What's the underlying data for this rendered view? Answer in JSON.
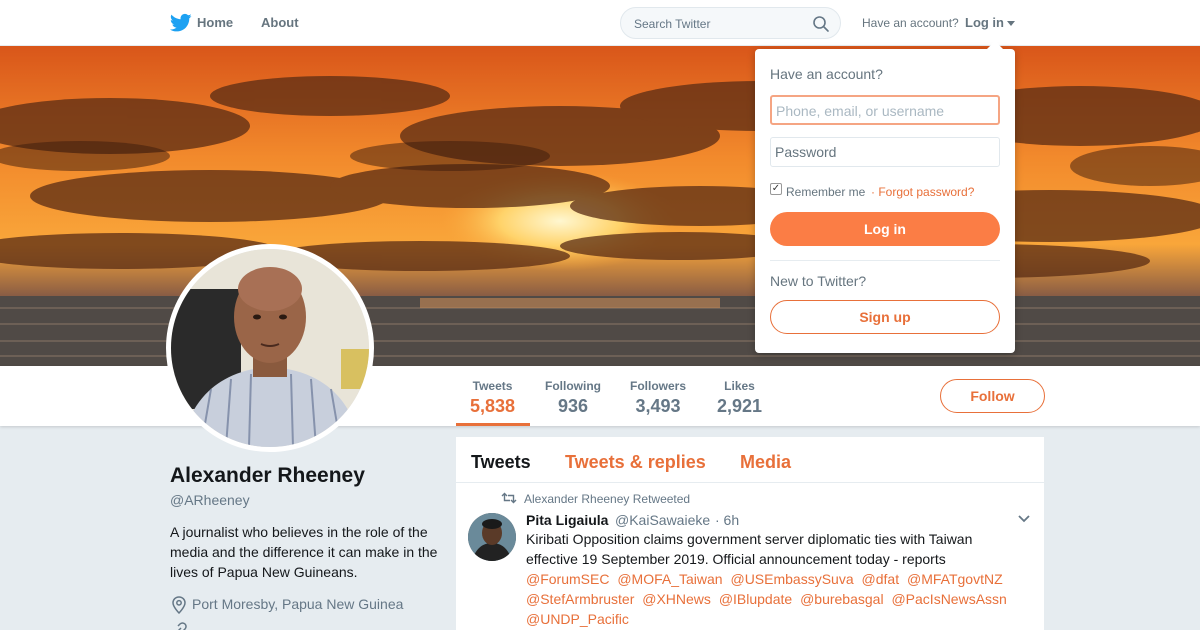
{
  "nav": {
    "home": "Home",
    "about": "About",
    "search_placeholder": "Search Twitter",
    "have_account": "Have an account?",
    "login": "Log in"
  },
  "profile": {
    "name": "Alexander Rheeney",
    "handle": "@ARheeney",
    "bio": "A journalist who believes in the role of the media and the difference it can make in the lives of Papua New Guineans.",
    "location": "Port Moresby, Papua New Guinea"
  },
  "stats": [
    {
      "label": "Tweets",
      "value": "5,838"
    },
    {
      "label": "Following",
      "value": "936"
    },
    {
      "label": "Followers",
      "value": "3,493"
    },
    {
      "label": "Likes",
      "value": "2,921"
    }
  ],
  "follow_label": "Follow",
  "tabs": [
    "Tweets",
    "Tweets & replies",
    "Media"
  ],
  "tweet": {
    "retweeted_by": "Alexander Rheeney Retweeted",
    "author_name": "Pita Ligaiula",
    "author_handle": "@KaiSawaieke",
    "time": "· 6h",
    "text": "Kiribati Opposition claims government server diplomatic ties with Taiwan effective 19 September 2019. Official announcement today - reports",
    "mentions": [
      "@ForumSEC",
      "@MOFA_Taiwan",
      "@USEmbassySuva",
      "@dfat",
      "@MFATgovtNZ",
      "@StefArmbruster",
      "@XHNews",
      "@IBlupdate",
      "@burebasgal",
      "@PacIsNewsAssn",
      "@UNDP_Pacific"
    ]
  },
  "login_dropdown": {
    "title": "Have an account?",
    "username_placeholder": "Phone, email, or username",
    "password_placeholder": "Password",
    "remember": "Remember me",
    "forgot": "· Forgot password?",
    "login_button": "Log in",
    "new_prompt": "New to Twitter?",
    "signup_button": "Sign up"
  },
  "colors": {
    "accent": "#e8703a",
    "login_button": "#fb7d45",
    "twitter_blue": "#1da1f2"
  },
  "icons": [
    "twitter-bird-icon",
    "search-icon",
    "caret-down-icon",
    "location-pin-icon",
    "link-icon",
    "retweet-icon",
    "chevron-down-icon"
  ]
}
